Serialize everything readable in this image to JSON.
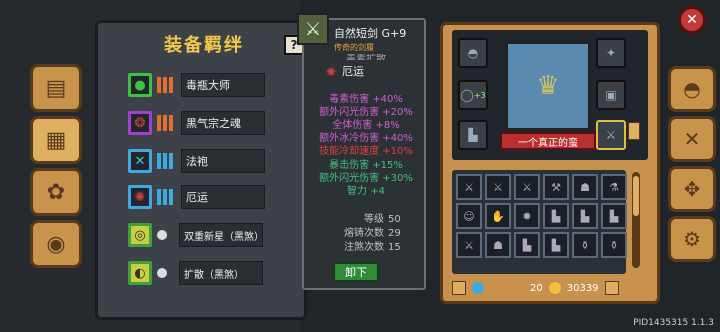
{
  "bond_panel": {
    "title": "装备羁绊",
    "help": "?",
    "bonds": [
      {
        "label": "毒瓶大师",
        "icon": "poison-flask-icon",
        "color": "#40c040"
      },
      {
        "label": "黑气宗之魂",
        "icon": "dark-spirit-icon",
        "color": "#a040d0"
      },
      {
        "label": "法袍",
        "icon": "robe-icon",
        "color": "#40a8e0"
      },
      {
        "label": "厄运",
        "icon": "doom-icon",
        "color": "#d04040"
      },
      {
        "label": "双重新星（黑煞）",
        "icon": "double-nova-icon",
        "color": "#40a040"
      },
      {
        "label": "扩散（黑煞）",
        "icon": "spread-icon",
        "color": "#40a040"
      }
    ]
  },
  "tooltip": {
    "name": "自然短剑 G+9",
    "subtitle": "传奇的剑履",
    "cut_line": "毒素扩散",
    "bond": "厄运",
    "stats": [
      {
        "text": "毒素伤害 +40%",
        "color": "#d060d0"
      },
      {
        "text": "额外闪光伤害 +20%",
        "color": "#d060d0"
      },
      {
        "text": "全体伤害 +8%",
        "color": "#d060d0"
      },
      {
        "text": "额外冰冷伤害 +40%",
        "color": "#d060d0"
      },
      {
        "text": "技能冷却速度 +10%",
        "color": "#e04040"
      },
      {
        "text": "暴击伤害 +15%",
        "color": "#40c080"
      },
      {
        "text": "额外闪光伤害 +30%",
        "color": "#40c080"
      },
      {
        "text": "智力 +4",
        "color": "#40c080"
      }
    ],
    "level_label": "等级",
    "level": "50",
    "forge_label": "熔铸次数",
    "forge": "29",
    "infuse_label": "注煞次数",
    "infuse": "15",
    "unequip": "卸下"
  },
  "inventory": {
    "character_name": "一个真正的蛮",
    "slot_badge": "+3",
    "gems": "20",
    "gold": "30339"
  },
  "player_id": "PID1435315 1.1.3",
  "close": "✕"
}
